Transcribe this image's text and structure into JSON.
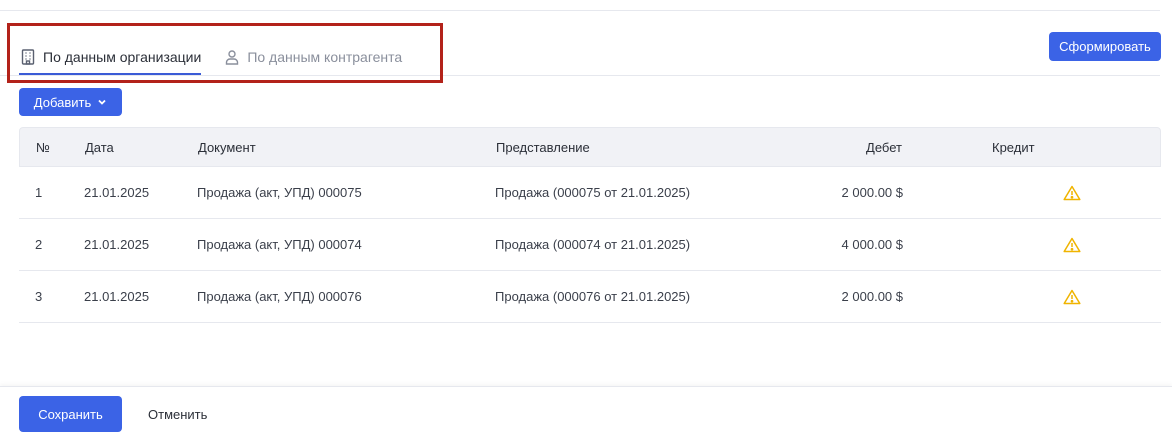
{
  "tabs": [
    {
      "label": "По данным организации",
      "icon": "building-icon",
      "active": true
    },
    {
      "label": "По данным контрагента",
      "icon": "person-icon",
      "active": false
    }
  ],
  "toolbar": {
    "form_label": "Сформировать",
    "add_label": "Добавить"
  },
  "table": {
    "headers": {
      "num": "№",
      "date": "Дата",
      "document": "Документ",
      "representation": "Представление",
      "debit": "Дебет",
      "credit": "Кредит"
    },
    "rows": [
      {
        "num": "1",
        "date": "21.01.2025",
        "document": "Продажа (акт, УПД) 000075",
        "representation": "Продажа (000075 от 21.01.2025)",
        "debit": "2 000.00 $",
        "credit_icon": "warning-icon"
      },
      {
        "num": "2",
        "date": "21.01.2025",
        "document": "Продажа (акт, УПД) 000074",
        "representation": "Продажа (000074 от 21.01.2025)",
        "debit": "4 000.00 $",
        "credit_icon": "warning-icon"
      },
      {
        "num": "3",
        "date": "21.01.2025",
        "document": "Продажа (акт, УПД) 000076",
        "representation": "Продажа (000076 от 21.01.2025)",
        "debit": "2 000.00 $",
        "credit_icon": "warning-icon"
      }
    ]
  },
  "footer": {
    "save_label": "Сохранить",
    "cancel_label": "Отменить"
  },
  "colors": {
    "primary": "#3b63e6",
    "highlight": "#b3221a",
    "warning": "#f0b400"
  }
}
